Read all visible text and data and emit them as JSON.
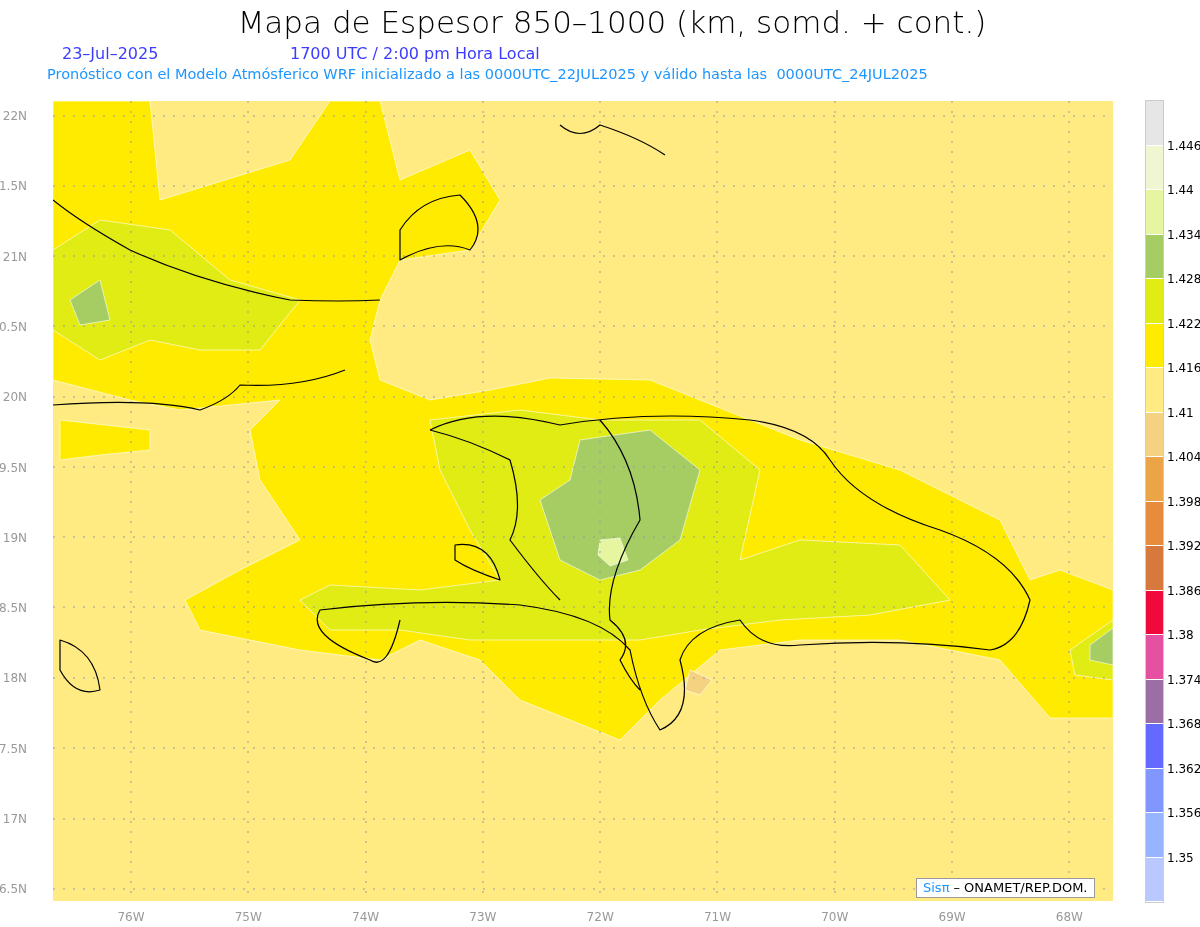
{
  "title": "Mapa de Espesor 850–1000 (km, somd. + cont.)",
  "date": "23–Jul–2025",
  "time": "1700 UTC / 2:00 pm Hora Local",
  "subtitle": "Pronóstico con el Modelo Atmósferico WRF inicializado a las 0000UTC_22JUL2025 y válido hasta las  0000UTC_24JUL2025",
  "lat_labels": [
    "22N",
    "1.5N",
    "21N",
    "0.5N",
    "20N",
    "9.5N",
    "19N",
    "8.5N",
    "18N",
    "7.5N",
    "17N",
    "6.5N"
  ],
  "lon_labels": [
    "76W",
    "75W",
    "74W",
    "73W",
    "72W",
    "71W",
    "70W",
    "69W",
    "68W"
  ],
  "legend_colors": [
    {
      "color": "#e6e6e6"
    },
    {
      "color": "#f0f5d2"
    },
    {
      "color": "#e6f5a0"
    },
    {
      "color": "#a5cd64"
    },
    {
      "color": "#e1eb14"
    },
    {
      "color": "#ffeb00"
    },
    {
      "color": "#ffeb82"
    },
    {
      "color": "#f5d282"
    },
    {
      "color": "#eba546"
    },
    {
      "color": "#e68c3c"
    },
    {
      "color": "#d7783c"
    },
    {
      "color": "#f00a3c"
    },
    {
      "color": "#e650a0"
    },
    {
      "color": "#9b6ea5"
    },
    {
      "color": "#6469ff"
    },
    {
      "color": "#8296ff"
    },
    {
      "color": "#96b4ff"
    },
    {
      "color": "#b9c8ff"
    }
  ],
  "legend_labels": [
    "1.446",
    "1.44",
    "1.434",
    "1.428",
    "1.422",
    "1.416",
    "1.41",
    "1.404",
    "1.398",
    "1.392",
    "1.386",
    "1.38",
    "1.374",
    "1.368",
    "1.362",
    "1.356",
    "1.35"
  ],
  "credit": {
    "brand": "Sisπ",
    "text": "– ONAMET/REP.DOM."
  }
}
